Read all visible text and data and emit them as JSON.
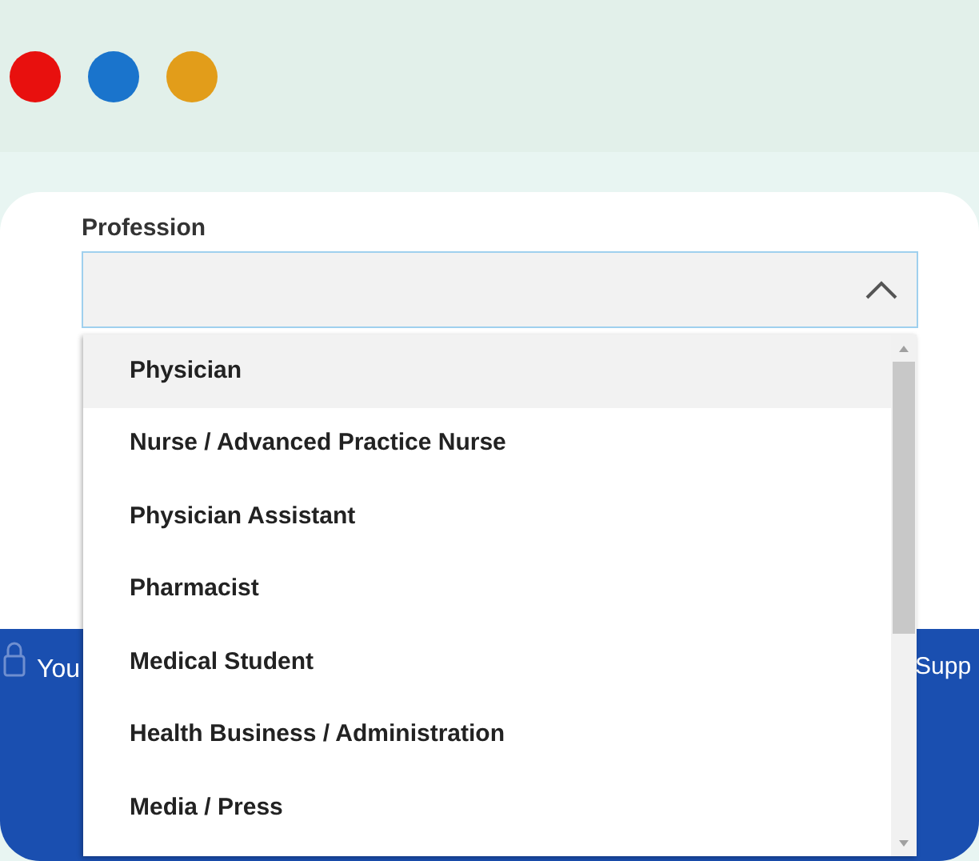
{
  "window_controls": [
    {
      "color": "#e8100e"
    },
    {
      "color": "#1a74cc"
    },
    {
      "color": "#e29d1a"
    }
  ],
  "field": {
    "label": "Profession",
    "expanded": true
  },
  "options": [
    {
      "label": "Physician",
      "selected": true
    },
    {
      "label": "Nurse / Advanced Practice Nurse",
      "selected": false
    },
    {
      "label": "Physician Assistant",
      "selected": false
    },
    {
      "label": "Pharmacist",
      "selected": false
    },
    {
      "label": "Medical Student",
      "selected": false
    },
    {
      "label": "Health Business / Administration",
      "selected": false
    },
    {
      "label": "Media / Press",
      "selected": false
    }
  ],
  "footer": {
    "left_text": "You",
    "right_text": "Supp"
  }
}
